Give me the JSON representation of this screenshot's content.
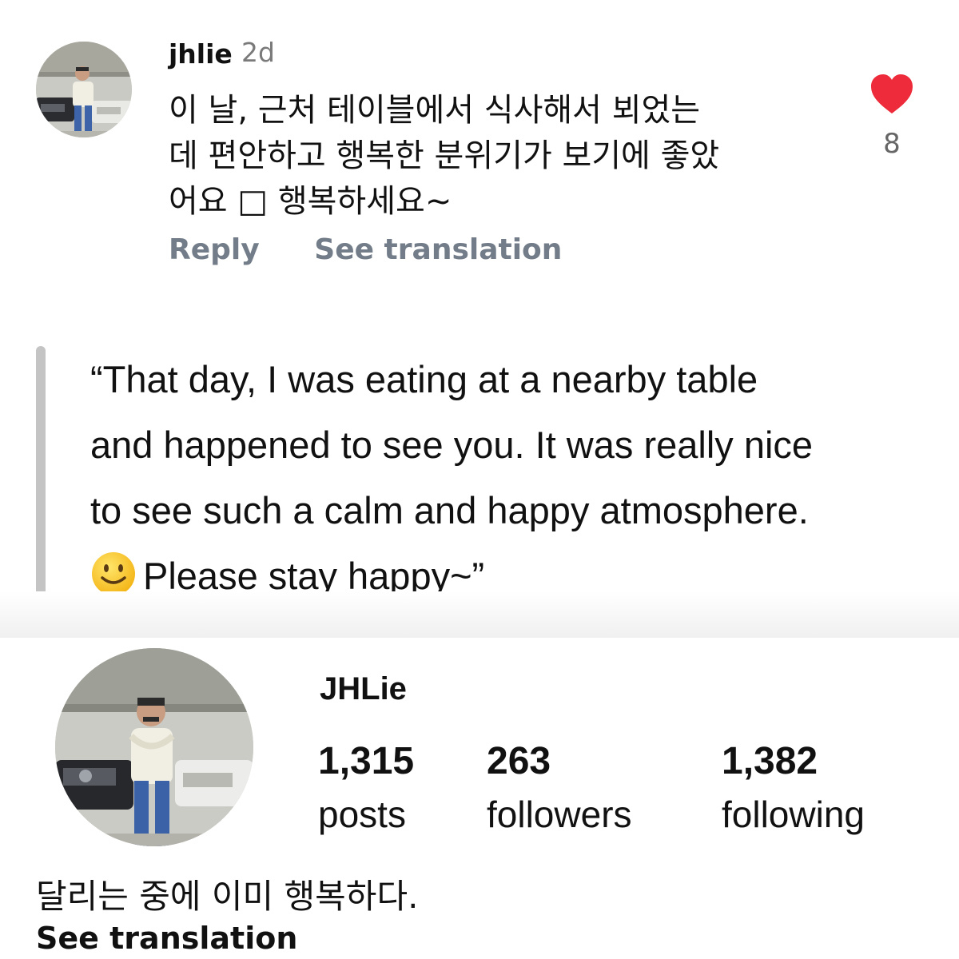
{
  "comment": {
    "avatar_icon": "user-avatar-photo",
    "username": "jhlie",
    "timestamp": "2d",
    "text_lines": [
      "이 날, 근처 테이블에서 식사해서 뵈었는",
      "데 편안하고 행복한 분위기가 보기에 좋았",
      "어요 □ 행복하세요~"
    ],
    "reply_label": "Reply",
    "see_translation_label": "See translation",
    "like_icon": "heart-icon",
    "like_color": "#ed2b3a",
    "like_count": "8"
  },
  "translation": {
    "lines": [
      "“That day, I was eating at a nearby table",
      "and happened to see you. It was really nice",
      "to see such a calm and happy atmosphere."
    ],
    "emoji_icon": "slightly-smiling-face-emoji",
    "last_line": "Please stay happy~”"
  },
  "profile": {
    "avatar_icon": "user-avatar-photo",
    "display_name": "JHLie",
    "stats": {
      "posts": {
        "value": "1,315",
        "label": "posts"
      },
      "followers": {
        "value": "263",
        "label": "followers"
      },
      "following": {
        "value": "1,382",
        "label": "following"
      }
    },
    "bio": "달리는 중에 이미 행복하다.",
    "see_translation_label": "See translation"
  }
}
